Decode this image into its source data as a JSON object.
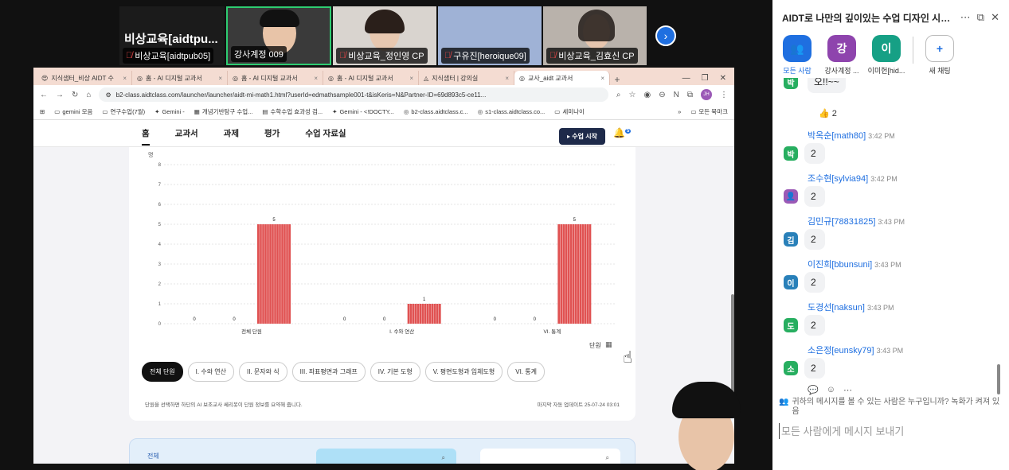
{
  "meeting": {
    "host_label": "비상교육[aidtpu...",
    "tiles": [
      {
        "name": "비상교육[aidtpub05]",
        "muted": true
      },
      {
        "name": "강사계정 009",
        "muted": false
      },
      {
        "name": "비상교육_정인영 CP",
        "muted": true
      },
      {
        "name": "구유진[heroique09]",
        "muted": true
      },
      {
        "name": "비상교육_김효신 CP",
        "muted": true
      }
    ]
  },
  "browser": {
    "tabs": [
      {
        "label": "지식샘터_비상 AIDT 수",
        "active": false
      },
      {
        "label": "홈 - AI 디지털 교과서",
        "active": false
      },
      {
        "label": "홈 - AI 디지털 교과서",
        "active": false
      },
      {
        "label": "홈 - AI 디지털 교과서",
        "active": false
      },
      {
        "label": "지식샘터 | 강의실",
        "active": false
      },
      {
        "label": "교사_aidt 교과서",
        "active": true
      }
    ],
    "url": "b2-class.aidtclass.com/launcher/launcher/aidt-mi-math1.html?userId=edmathsample001-t&isKeris=N&Partner-ID=69d893c5-ce11...",
    "bookmarks": [
      "gemini 모음",
      "연구수업(7월)",
      "Gemini -",
      "개념기반탐구 수업...",
      "수학수업 효과성 검...",
      "Gemini - <!DOCTY...",
      "b2-class.aidtclass.c...",
      "s1-class.aidtclass.co...",
      "세미나이",
      "모든 북마크"
    ]
  },
  "app": {
    "nav": [
      "홈",
      "교과서",
      "과제",
      "평가",
      "수업 자료실"
    ],
    "start_button": "수업 시작",
    "bell_badge": "5",
    "unit_label": "단원",
    "filters": [
      "전체 단원",
      "I. 수와 연산",
      "II. 문자와 식",
      "III. 좌표평면과 그래프",
      "IV. 기본 도형",
      "V. 평면도형과 입체도형",
      "VI. 통계"
    ],
    "note": "단원을 선택하면 하단의 AI 보조교사 쎄리봇이 단원 정보를 요약해 줍니다.",
    "updated": "마지막 자동 업데이트 25-07-24 03:01",
    "bottom_tag": "전체"
  },
  "chart_data": {
    "type": "bar",
    "categories": [
      "",
      "",
      "전체 단원",
      "",
      "",
      "I. 수와 연산",
      "",
      "",
      "VI. 통계"
    ],
    "values": [
      0,
      0,
      5,
      0,
      0,
      1,
      0,
      0,
      5
    ],
    "ylim": [
      0,
      8
    ],
    "yticks": [
      0,
      1,
      2,
      3,
      4,
      5,
      6,
      7,
      8
    ],
    "ylabel": "명",
    "color": "#e05252"
  },
  "chat": {
    "title": "AIDT로 나만의 깊이있는 수업 디자인 시작...",
    "recipients": [
      {
        "label": "모든 사람",
        "initial": "",
        "color": "#1f6fe0"
      },
      {
        "label": "강사계정 ...",
        "initial": "강",
        "color": "#8e44ad"
      },
      {
        "label": "이미헌[hid...",
        "initial": "이",
        "color": "#16a085"
      },
      {
        "label": "새 채팅",
        "initial": "+",
        "color": "#ffffff"
      }
    ],
    "messages": [
      {
        "sender": "",
        "time": "",
        "text": "오!!~~",
        "initial": "박",
        "color": "#27ae60",
        "reaction": "👍 2"
      },
      {
        "sender": "박옥순[math80]",
        "time": "3:42 PM",
        "text": "2",
        "initial": "박",
        "color": "#27ae60"
      },
      {
        "sender": "조수현[sylvia94]",
        "time": "3:42 PM",
        "text": "2",
        "initial": "",
        "color": "#9b59b6"
      },
      {
        "sender": "김민규[78831825]",
        "time": "3:43 PM",
        "text": "2",
        "initial": "김",
        "color": "#2980b9"
      },
      {
        "sender": "이진희[bbunsuni]",
        "time": "3:43 PM",
        "text": "2",
        "initial": "이",
        "color": "#2980b9"
      },
      {
        "sender": "도경선[naksun]",
        "time": "3:43 PM",
        "text": "2",
        "initial": "도",
        "color": "#27ae60"
      },
      {
        "sender": "소은정[eunsky79]",
        "time": "3:43 PM",
        "text": "2",
        "initial": "소",
        "color": "#27ae60"
      }
    ],
    "privacy_note": "귀하의 메시지를 볼 수 있는 사람은 누구입니까? 녹화가 켜져 있음",
    "input_placeholder": "모든 사람에게 메시지 보내기"
  }
}
